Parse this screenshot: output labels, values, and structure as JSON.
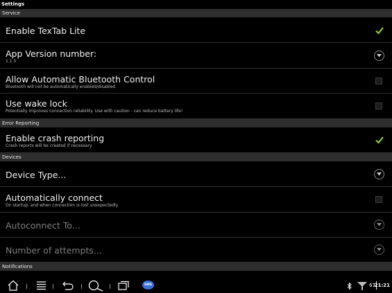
{
  "window": {
    "title": "Settings"
  },
  "sections": {
    "service": "Service",
    "error_reporting": "Error Reporting",
    "devices": "Devices",
    "notifications": "Notifications"
  },
  "service": {
    "enable_textab": {
      "title": "Enable TexTab Lite",
      "checked": true
    },
    "app_version": {
      "title": "App Version number:",
      "value": "1.1.5"
    },
    "bluetooth": {
      "title": "Allow Automatic Bluetooth Control",
      "summary": "Bluetooth will not be automatically enabled/disabled",
      "checked": false
    },
    "wake_lock": {
      "title": "Use wake lock",
      "summary": "Potentially improves connection reliability. Use with caution - can reduce battery life!",
      "checked": false
    }
  },
  "error_reporting": {
    "crash": {
      "title": "Enable crash reporting",
      "summary": "Crash reports will be created if necessary",
      "checked": true
    }
  },
  "devices": {
    "device_type": {
      "title": "Device Type..."
    },
    "auto_connect": {
      "title": "Automatically connect",
      "summary": "On startup, and when connection is lost unexpectedly",
      "checked": false
    },
    "autoconnect_to": {
      "title": "Autoconnect To...",
      "enabled": false
    },
    "attempts": {
      "title": "Number of attempts...",
      "enabled": false
    }
  },
  "navbar": {
    "sms_label": "SMS",
    "battery_level": "63",
    "time": "21:21"
  },
  "colors": {
    "accent_check": "#8dc63f",
    "section_bg": "#2e2e2e",
    "sms_badge": "#3b6fd4"
  },
  "icons": [
    "check-icon",
    "chevron-down-icon",
    "home-icon",
    "menu-icon",
    "back-icon",
    "search-icon",
    "recent-apps-icon",
    "sms-icon",
    "bluetooth-icon",
    "signal-icon"
  ]
}
